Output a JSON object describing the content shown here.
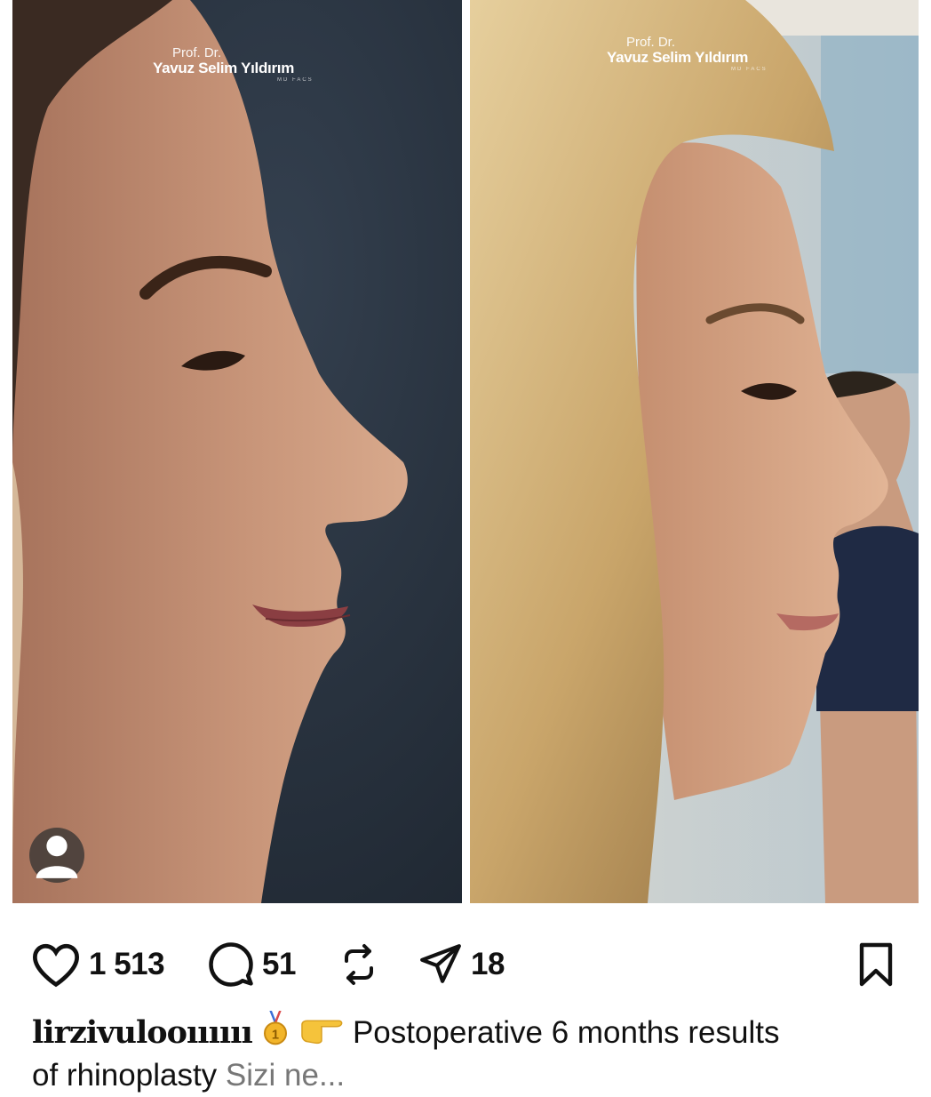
{
  "post": {
    "watermark_before": {
      "prefix": "Prof. Dr.",
      "name": "Yavuz Selim Yıldırım",
      "credentials": "MD FACS"
    },
    "watermark_after": {
      "prefix": "Prof. Dr.",
      "name": "Yavuz Selim Yıldırım",
      "credentials": "MD FACS"
    },
    "tag_icon": "user-tag-icon"
  },
  "actions": {
    "likes": "1 513",
    "comments": "51",
    "reposts": "",
    "shares": "18",
    "icons": [
      "heart-icon",
      "comment-icon",
      "repost-icon",
      "send-icon",
      "bookmark-icon"
    ]
  },
  "caption": {
    "username": "lirzivulooıııııı",
    "emojis": [
      "medal-icon",
      "pointing-hand-icon"
    ],
    "text": "Postoperative 6 months results",
    "line2": "of rhinoplasty",
    "more": "Sizi ne..."
  },
  "colors": {
    "text": "#111111",
    "muted": "#777777",
    "before_bg": "#26303c"
  }
}
